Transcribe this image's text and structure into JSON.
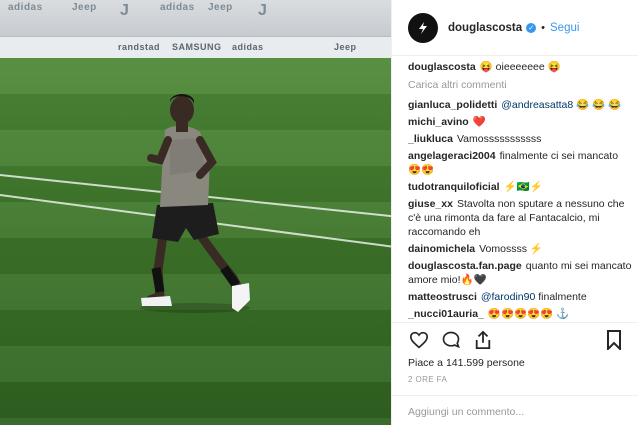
{
  "post": {
    "username": "douglascosta",
    "follow_label": "Segui",
    "dot": "•",
    "caption": {
      "user": "douglascosta",
      "text": "😝 oieeeeeee 😝"
    },
    "load_more": "Carica altri commenti",
    "comments": [
      {
        "user": "gianluca_polidetti",
        "mention": "@andreasatta8",
        "text": "😂 😂 😂"
      },
      {
        "user": "michi_avino",
        "mention": "",
        "text": "❤️"
      },
      {
        "user": "_liukluca",
        "mention": "",
        "text": "Vamosssssssssss"
      },
      {
        "user": "angelageraci2004",
        "mention": "",
        "text": "finalmente ci sei mancato 😍😍"
      },
      {
        "user": "tudotranquiloficial",
        "mention": "",
        "text": "⚡🇧🇷⚡"
      },
      {
        "user": "giuse_xx",
        "mention": "",
        "text": "Stavolta non sputare a nessuno che c'è una rimonta da fare al Fantacalcio, mi raccomando eh"
      },
      {
        "user": "dainomichela",
        "mention": "",
        "text": "Vomossss ⚡"
      },
      {
        "user": "douglascosta.fan.page",
        "mention": "",
        "text": "quanto mi sei mancato amore mio!🔥🖤"
      },
      {
        "user": "matteostrusci",
        "mention": "@farodin90",
        "text": "finalmente"
      },
      {
        "user": "_nucci01auria_",
        "mention": "",
        "text": "😍😍😍😍😍 ⚓"
      }
    ],
    "likes_text": "Piace a 141.599 persone",
    "time_text": "2 ORE FA",
    "add_comment_placeholder": "Aggiungi un commento..."
  },
  "photo": {
    "ads_top": [
      "adidas",
      "Jeep",
      "adidas",
      "Jeep"
    ],
    "ads_board": [
      "randstad",
      "SAMSUNG",
      "adidas",
      "Jeep"
    ]
  },
  "colors": {
    "link": "#3897f0",
    "verified": "#3897f0",
    "heart": "#ed4956",
    "pitch": "#3d7429"
  }
}
